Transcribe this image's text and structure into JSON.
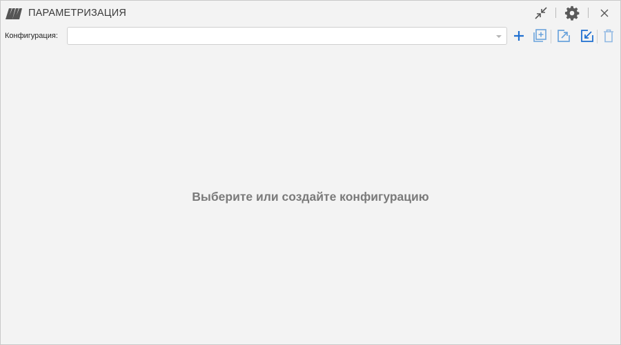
{
  "window": {
    "title": "ПАРАМЕТРИЗАЦИЯ",
    "logo_icon": "double-mountain-logo",
    "controls": {
      "collapse_icon": "collapse-arrows-icon",
      "settings_icon": "gear-icon",
      "close_icon": "close-icon"
    }
  },
  "toolbar": {
    "config_label": "Конфигурация:",
    "config_value": "",
    "actions": [
      {
        "name": "add",
        "icon": "plus-icon",
        "color": "#1e6fd0"
      },
      {
        "name": "duplicate",
        "icon": "copy-plus-icon",
        "color": "#6aa3dc"
      },
      {
        "name": "export",
        "icon": "export-arrow-icon",
        "color": "#6aa3dc"
      },
      {
        "name": "import",
        "icon": "import-arrow-icon",
        "color": "#1e6fd0"
      },
      {
        "name": "delete",
        "icon": "trash-icon",
        "color": "#8fb8e3"
      }
    ]
  },
  "content": {
    "empty_message": "Выберите или создайте конфигурацию"
  },
  "colors": {
    "window_bg": "#f3f3f3",
    "accent": "#1e6fd0",
    "accent_light": "#6aa3dc",
    "muted_text": "#7a7a7a"
  }
}
